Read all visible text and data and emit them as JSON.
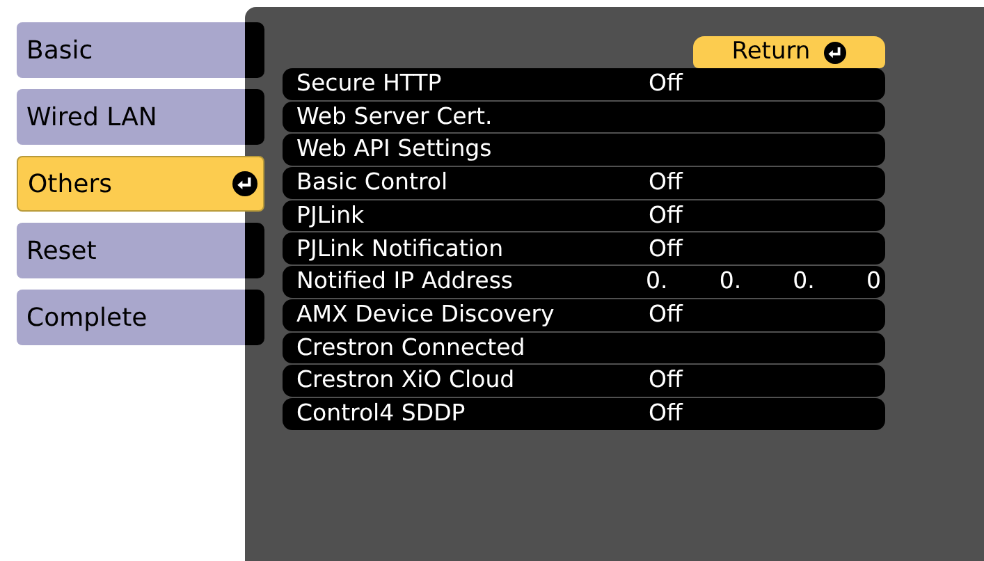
{
  "tabs": [
    {
      "label": "Basic",
      "selected": false
    },
    {
      "label": "Wired LAN",
      "selected": false
    },
    {
      "label": "Others",
      "selected": true
    },
    {
      "label": "Reset",
      "selected": false
    },
    {
      "label": "Complete",
      "selected": false
    }
  ],
  "return_button": {
    "label": "Return"
  },
  "settings": [
    {
      "label": "Secure HTTP",
      "kind": "text",
      "value": "Off"
    },
    {
      "label": "Web Server Cert.",
      "kind": "none"
    },
    {
      "label": "Web API Settings",
      "kind": "none"
    },
    {
      "label": "Basic Control",
      "kind": "text",
      "value": "Off"
    },
    {
      "label": "PJLink",
      "kind": "text",
      "value": "Off"
    },
    {
      "label": "PJLink Notification",
      "kind": "text",
      "value": "Off"
    },
    {
      "label": "Notified IP Address",
      "kind": "ip",
      "octets": [
        "0.",
        "0.",
        "0.",
        "0"
      ]
    },
    {
      "label": "AMX Device Discovery",
      "kind": "text",
      "value": "Off"
    },
    {
      "label": "Crestron Connected",
      "kind": "none"
    },
    {
      "label": "Crestron XiO Cloud",
      "kind": "text",
      "value": "Off"
    },
    {
      "label": "Control4 SDDP",
      "kind": "text",
      "value": "Off"
    }
  ]
}
